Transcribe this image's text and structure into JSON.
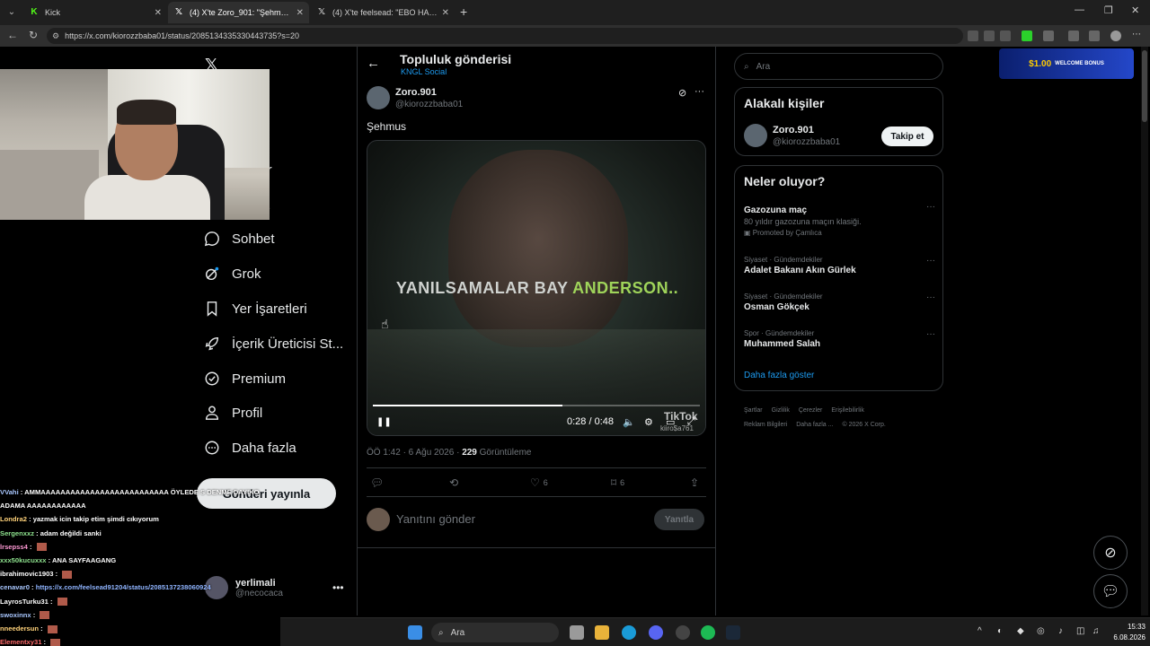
{
  "browser": {
    "tabs": [
      {
        "label": "Kick",
        "icon": "kick-icon",
        "active": false
      },
      {
        "label": "(4) X'te Zoro_901: \"Şehmus h",
        "icon": "x-icon",
        "active": true
      },
      {
        "label": "(4) X'te feelsead: \"EBO HARBİCİ R",
        "icon": "x-icon",
        "active": false
      }
    ],
    "url": "https://x.com/kiorozzbaba01/status/2085134335330443735?s=20"
  },
  "nav": {
    "items": [
      {
        "label": "Sohbet",
        "icon": "chat-icon"
      },
      {
        "label": "Grok",
        "icon": "grok-icon"
      },
      {
        "label": "Yer İşaretleri",
        "icon": "bookmark-icon"
      },
      {
        "label": "İçerik Üreticisi St...",
        "icon": "rocket-icon"
      },
      {
        "label": "Premium",
        "icon": "verified-icon"
      },
      {
        "label": "Profil",
        "icon": "person-icon"
      },
      {
        "label": "Daha fazla",
        "icon": "more-circle-icon"
      }
    ],
    "partial": [
      "fa",
      "ler",
      "t"
    ],
    "post_button": "Gönderi yayınla",
    "account": {
      "name": "yerlimali",
      "handle": "@necocaca"
    }
  },
  "post": {
    "header_title": "Topluluk gönderisi",
    "header_sub": "KNGL Social",
    "author_name": "Zoro.901",
    "author_handle": "@kiorozzbaba01",
    "text": "Şehmus",
    "video": {
      "caption_1": "YANILSAMALAR BAY",
      "caption_2": "ANDERSON..",
      "time": "0:28 / 0:48",
      "progress": 0.58,
      "watermark": "TikTok",
      "watermark_user": "kiiro$a761"
    },
    "meta_time": "ÖÖ 1:42 · 6 Ağu 2026 · ",
    "views": "229",
    "views_label": " Görüntüleme",
    "likes": "6",
    "bookmarks": "6",
    "reply_placeholder": "Yanıtını gönder",
    "reply_button": "Yanıtla"
  },
  "sidebar": {
    "search_placeholder": "Ara",
    "related_title": "Alakalı kişiler",
    "related": {
      "name": "Zoro.901",
      "handle": "@kiorozzbaba01",
      "button": "Takip et"
    },
    "trends_title": "Neler oluyor?",
    "trends": [
      {
        "category": "",
        "name": "Gazozuna maç",
        "desc": "80 yıldır gazozuna maçın klasiği.",
        "promo": "Promoted by Çamlıca"
      },
      {
        "category": "Siyaset · Gündemdekiler",
        "name": "Adalet Bakanı Akın Gürlek"
      },
      {
        "category": "Siyaset · Gündemdekiler",
        "name": "Osman Gökçek"
      },
      {
        "category": "Spor · Gündemdekiler",
        "name": "Muhammed Salah"
      }
    ],
    "show_more": "Daha fazla göster",
    "footer": [
      "Şartlar",
      "Gizlilik",
      "Çerezler",
      "Erişilebilirlik",
      "Reklam Bilgileri",
      "Daha fazla ...",
      "© 2026 X Corp."
    ]
  },
  "ad": {
    "amount": "$1.00",
    "text": "WELCOME BONUS"
  },
  "chat": [
    {
      "user": "VVahi",
      "color": "#a9c7ff",
      "msg": "AMMAAAAAAAAAAAAAAAAAAAAAAAAAA ÖYLEDE S DENME DAYIKO"
    },
    {
      "user": "",
      "color": "#fff",
      "msg": "ADAMA AAAAAAAAAAAA"
    },
    {
      "user": "Londra2",
      "color": "#ffd27a",
      "msg": "yazmak icin takip etim şimdi cıkıyorum"
    },
    {
      "user": "Sergenxxz",
      "color": "#8ee28e",
      "msg": "adam değildi sanki"
    },
    {
      "user": "lrsepss4",
      "color": "#ff9ad5",
      "msg": "",
      "emote": true
    },
    {
      "user": "xxx50kucuxxx",
      "color": "#8ee28e",
      "msg": "ANA SAYFAAGANG"
    },
    {
      "user": "ibrahimovic1903",
      "color": "#fff",
      "msg": "",
      "emote": true
    },
    {
      "user": "cenavar0",
      "color": "#a9c7ff",
      "msg": "https://x.com/feelsead91204/status/2085137238060924",
      "link": true
    },
    {
      "user": "LayrosTurku31",
      "color": "#fff",
      "msg": "",
      "emote": true
    },
    {
      "user": "swoxinnx",
      "color": "#a9c7ff",
      "msg": "",
      "emote": true
    },
    {
      "user": "nneedersun",
      "color": "#ffd27a",
      "msg": "",
      "emote": true
    },
    {
      "user": "Elementxy31",
      "color": "#ff6b6b",
      "msg": "",
      "emote": true
    }
  ],
  "taskbar": {
    "search": "Ara",
    "time": "15:33",
    "date": "6.08.2026"
  }
}
